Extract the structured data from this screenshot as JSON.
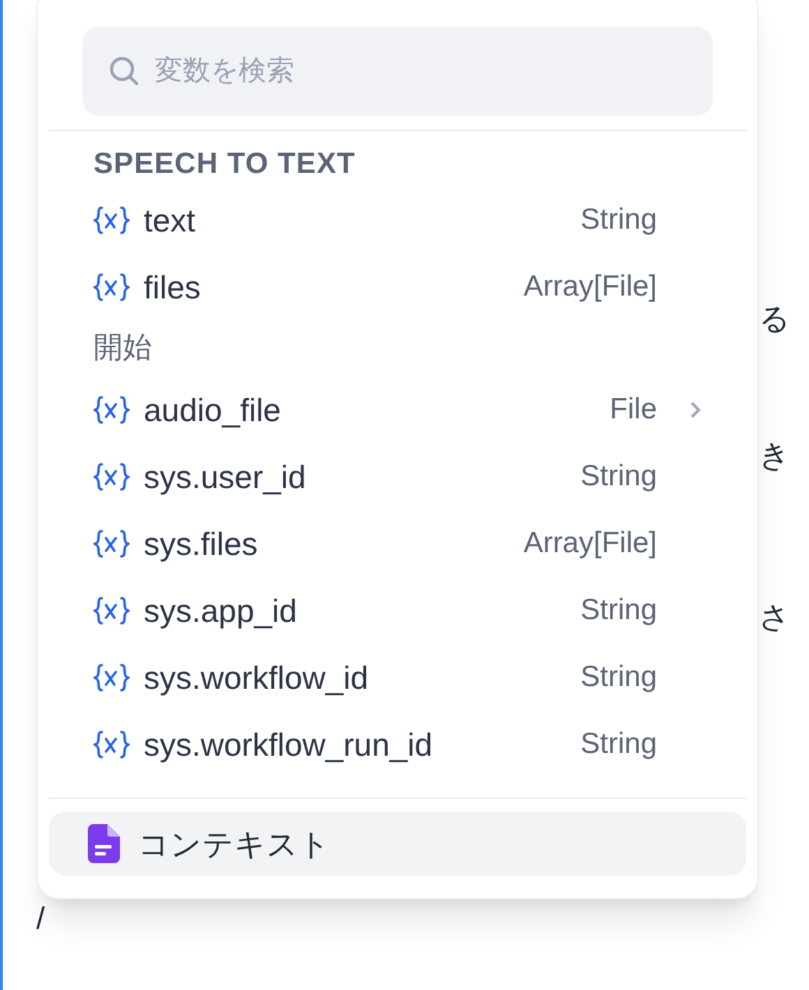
{
  "search": {
    "placeholder": "変数を検索"
  },
  "groups": [
    {
      "title": "SPEECH TO TEXT",
      "kind": "node",
      "variables": [
        {
          "name": "text",
          "type": "String",
          "expandable": false
        },
        {
          "name": "files",
          "type": "Array[File]",
          "expandable": false
        }
      ]
    },
    {
      "title": "開始",
      "kind": "start",
      "variables": [
        {
          "name": "audio_file",
          "type": "File",
          "expandable": true
        },
        {
          "name": "sys.user_id",
          "type": "String",
          "expandable": false
        },
        {
          "name": "sys.files",
          "type": "Array[File]",
          "expandable": false
        },
        {
          "name": "sys.app_id",
          "type": "String",
          "expandable": false
        },
        {
          "name": "sys.workflow_id",
          "type": "String",
          "expandable": false
        },
        {
          "name": "sys.workflow_run_id",
          "type": "String",
          "expandable": false
        }
      ]
    }
  ],
  "context_item": {
    "label": "コンテキスト"
  },
  "editor": {
    "fragments": [
      "る",
      "き",
      "さ"
    ],
    "input": "/"
  }
}
